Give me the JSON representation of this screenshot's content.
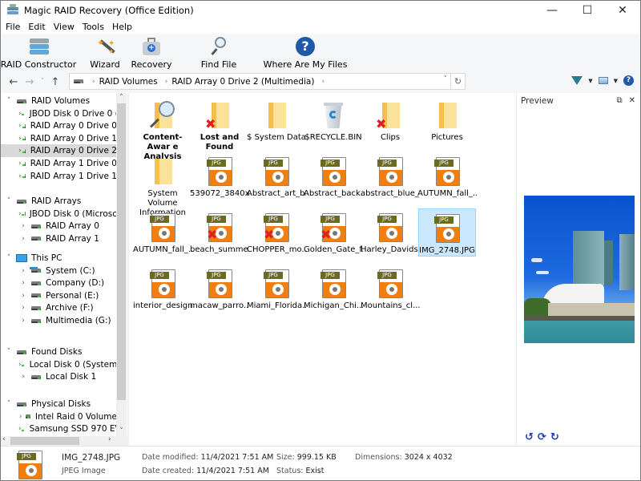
{
  "window": {
    "title": "Magic RAID Recovery (Office Edition)",
    "controls": {
      "minimize": "—",
      "maximize": "☐",
      "close": "✕"
    }
  },
  "menu": [
    "File",
    "Edit",
    "View",
    "Tools",
    "Help"
  ],
  "toolbar": {
    "raid_constructor": "RAID Constructor",
    "wizard": "Wizard",
    "recovery": "Recovery",
    "find_file": "Find File",
    "where_are_my_files": "Where Are My Files"
  },
  "nav": {
    "back": "←",
    "forward": "→",
    "history": "˅",
    "up": "↑",
    "breadcrumbs": [
      "RAID Volumes",
      "RAID Array 0 Drive 2 (Multimedia)"
    ],
    "sep": "›",
    "refresh": "↻",
    "dropdown": "˅"
  },
  "tree": {
    "groups": [
      {
        "label": "RAID Volumes",
        "items": [
          "JBOD Disk 0 Drive 0 (",
          "RAID Array 0 Drive 0",
          "RAID Array 0 Drive 1",
          "RAID Array 0 Drive 2",
          "RAID Array 1 Drive 0",
          "RAID Array 1 Drive 1"
        ]
      },
      {
        "label": "RAID Arrays",
        "items": [
          "JBOD Disk 0 (Microsc",
          "RAID Array 0",
          "RAID Array 1"
        ]
      },
      {
        "label": "This PC",
        "items": [
          "System (C:)",
          "Company (D:)",
          "Personal (E:)",
          "Archive (F:)",
          "Multimedia (G:)"
        ]
      },
      {
        "label": "Found Disks",
        "items": [
          "Local Disk 0 (System",
          "Local Disk 1"
        ]
      },
      {
        "label": "Physical Disks",
        "items": [
          "Intel Raid 0 Volume",
          "Samsung SSD 970 EV"
        ]
      }
    ],
    "selected": "RAID Array 0 Drive 2",
    "expanded_glyph": "˅",
    "collapsed_glyph": "›"
  },
  "files": [
    {
      "name": "Content-Awar e Analysis",
      "type": "search",
      "bold": true
    },
    {
      "name": "Lost and Found",
      "type": "folder",
      "deleted": true,
      "bold": true
    },
    {
      "name": "$ System Data",
      "type": "folder"
    },
    {
      "name": "$RECYCLE.BIN",
      "type": "recycle"
    },
    {
      "name": "Clips",
      "type": "folder",
      "deleted": true
    },
    {
      "name": "Pictures",
      "type": "folder"
    },
    {
      "name": "System Volume Information",
      "type": "folder"
    },
    {
      "name": "539072_3840x...",
      "type": "jpg"
    },
    {
      "name": "Abstract_art_b...",
      "type": "jpg"
    },
    {
      "name": "Abstract_back...",
      "type": "jpg"
    },
    {
      "name": "abstract_blue_...",
      "type": "jpg"
    },
    {
      "name": "AUTUMN_fall_...",
      "type": "jpg"
    },
    {
      "name": "AUTUMN_fall_...",
      "type": "jpg"
    },
    {
      "name": "beach_summe...",
      "type": "jpg",
      "deleted": true
    },
    {
      "name": "CHOPPER_mo...",
      "type": "jpg",
      "deleted": true
    },
    {
      "name": "Golden_Gate_f...",
      "type": "jpg",
      "deleted": true
    },
    {
      "name": "Harley_Davids...",
      "type": "jpg"
    },
    {
      "name": "IMG_2748.JPG",
      "type": "jpg",
      "selected": true
    },
    {
      "name": "interior_design...",
      "type": "jpg"
    },
    {
      "name": "macaw_parro...",
      "type": "jpg"
    },
    {
      "name": "Miami_Florida...",
      "type": "jpg"
    },
    {
      "name": "Michigan_Chi...",
      "type": "jpg"
    },
    {
      "name": "Mountains_cl...",
      "type": "jpg"
    }
  ],
  "jpg_tag": "JPG",
  "preview": {
    "title": "Preview",
    "undock": "⧉",
    "close": "✕",
    "rotate_left": "↺",
    "flip": "⟳",
    "rotate_right": "↻"
  },
  "status": {
    "file_name": "IMG_2748.JPG",
    "file_type": "JPEG Image",
    "date_modified_label": "Date modified:",
    "date_modified": "11/4/2021 7:51 AM",
    "date_created_label": "Date created:",
    "date_created": "11/4/2021 7:51 AM",
    "size_label": "Size:",
    "size": "999.15 KB",
    "status_label": "Status:",
    "status_value": "Exist",
    "dimensions_label": "Dimensions:",
    "dimensions": "3024 x 4032"
  }
}
